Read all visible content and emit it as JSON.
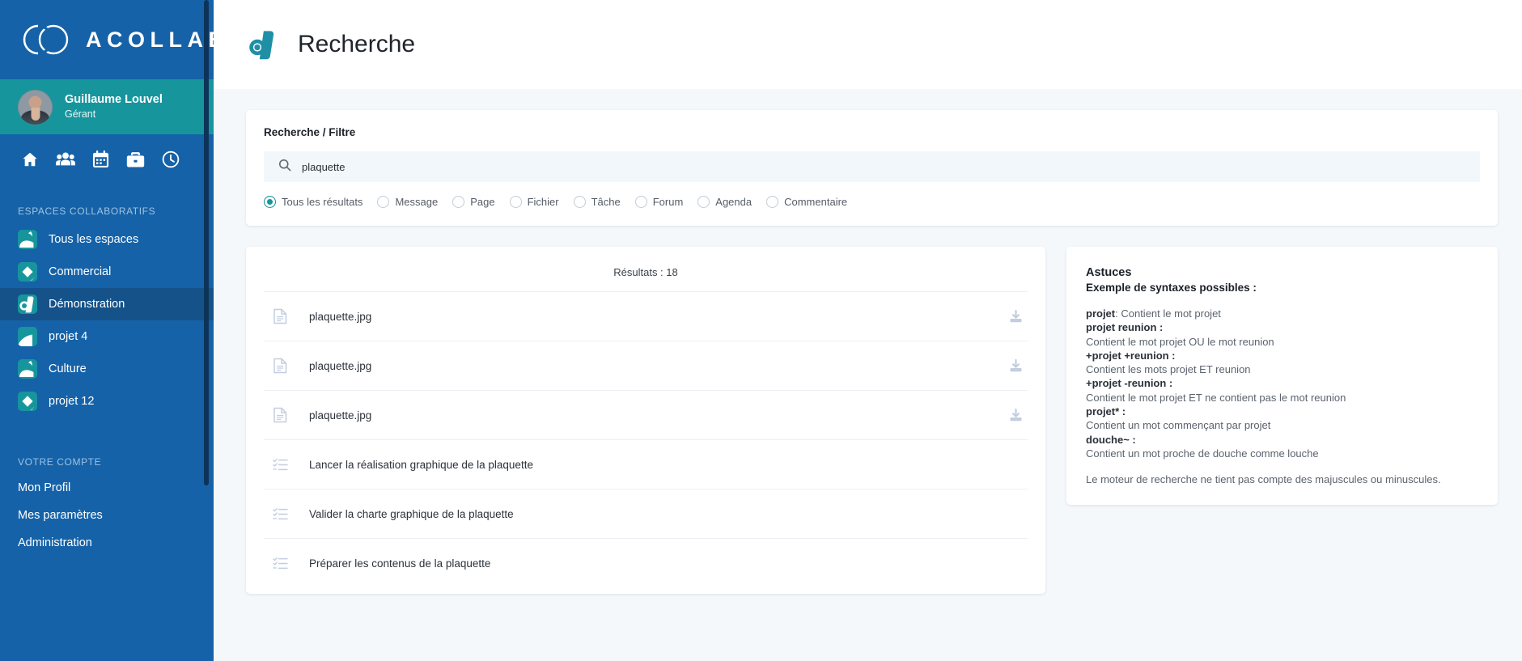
{
  "brand": {
    "name": "ACOLLAB",
    "logo_icon": "acollab-rings-logo"
  },
  "user": {
    "name": "Guillaume Louvel",
    "role": "Gérant",
    "avatar_icon": "user-avatar"
  },
  "quick_nav": [
    {
      "icon": "home-icon",
      "name": "home"
    },
    {
      "icon": "users-icon",
      "name": "users"
    },
    {
      "icon": "calendar-icon",
      "name": "calendar"
    },
    {
      "icon": "briefcase-icon",
      "name": "briefcase"
    },
    {
      "icon": "clock-icon",
      "name": "clock"
    }
  ],
  "sidebar": {
    "spaces_title": "ESPACES COLLABORATIFS",
    "spaces": [
      {
        "label": "Tous les espaces",
        "icon": "space-icon-all",
        "active": false
      },
      {
        "label": "Commercial",
        "icon": "space-icon-commercial",
        "active": false
      },
      {
        "label": "Démonstration",
        "icon": "space-icon-demonstration",
        "active": true
      },
      {
        "label": "projet 4",
        "icon": "space-icon-projet-4",
        "active": false
      },
      {
        "label": "Culture",
        "icon": "space-icon-culture",
        "active": false
      },
      {
        "label": "projet 12",
        "icon": "space-icon-projet-12",
        "active": false
      }
    ],
    "account_title": "VOTRE COMPTE",
    "account_links": [
      {
        "label": "Mon Profil"
      },
      {
        "label": "Mes paramètres"
      },
      {
        "label": "Administration"
      }
    ]
  },
  "header": {
    "title": "Recherche",
    "logo_icon": "acollab-mark"
  },
  "filter": {
    "panel_title": "Recherche / Filtre",
    "search_icon": "search-icon",
    "search_value": "plaquette",
    "search_placeholder": "",
    "options": [
      {
        "label": "Tous les résultats",
        "selected": true
      },
      {
        "label": "Message",
        "selected": false
      },
      {
        "label": "Page",
        "selected": false
      },
      {
        "label": "Fichier",
        "selected": false
      },
      {
        "label": "Tâche",
        "selected": false
      },
      {
        "label": "Forum",
        "selected": false
      },
      {
        "label": "Agenda",
        "selected": false
      },
      {
        "label": "Commentaire",
        "selected": false
      }
    ]
  },
  "results": {
    "count_label": "Résultats : 18",
    "items": [
      {
        "label": "plaquette.jpg",
        "icon": "file-icon",
        "action": "download-icon"
      },
      {
        "label": "plaquette.jpg",
        "icon": "file-icon",
        "action": "download-icon"
      },
      {
        "label": "plaquette.jpg",
        "icon": "file-icon",
        "action": "download-icon"
      },
      {
        "label": "Lancer la réalisation graphique de la plaquette",
        "icon": "task-list-icon",
        "action": ""
      },
      {
        "label": "Valider la charte graphique de la plaquette",
        "icon": "task-list-icon",
        "action": ""
      },
      {
        "label": "Préparer les contenus de la plaquette",
        "icon": "task-list-icon",
        "action": ""
      }
    ]
  },
  "tips": {
    "title": "Astuces",
    "subtitle": "Exemple de syntaxes possibles :",
    "entries": [
      {
        "term": "projet",
        "def": ": Contient le mot projet",
        "inline": true
      },
      {
        "term": "projet reunion :",
        "def": "Contient le mot projet OU le mot reunion",
        "inline": false
      },
      {
        "term": "+projet +reunion :",
        "def": "Contient les mots projet ET reunion",
        "inline": false
      },
      {
        "term": "+projet -reunion :",
        "def": "Contient le mot projet ET ne contient pas le mot reunion",
        "inline": false
      },
      {
        "term": "projet* :",
        "def": "Contient un mot commençant par projet",
        "inline": false
      },
      {
        "term": "douche~ :",
        "def": "Contient un mot proche de douche comme louche",
        "inline": false
      }
    ],
    "note": "Le moteur de recherche ne tient pas compte des majuscules ou minuscules."
  },
  "colors": {
    "sidebar_blue": "#1562a8",
    "teal": "#17959c",
    "active_item": "#155289",
    "page_bg": "#f4f8fb",
    "scrollbar": "#0d3458"
  }
}
